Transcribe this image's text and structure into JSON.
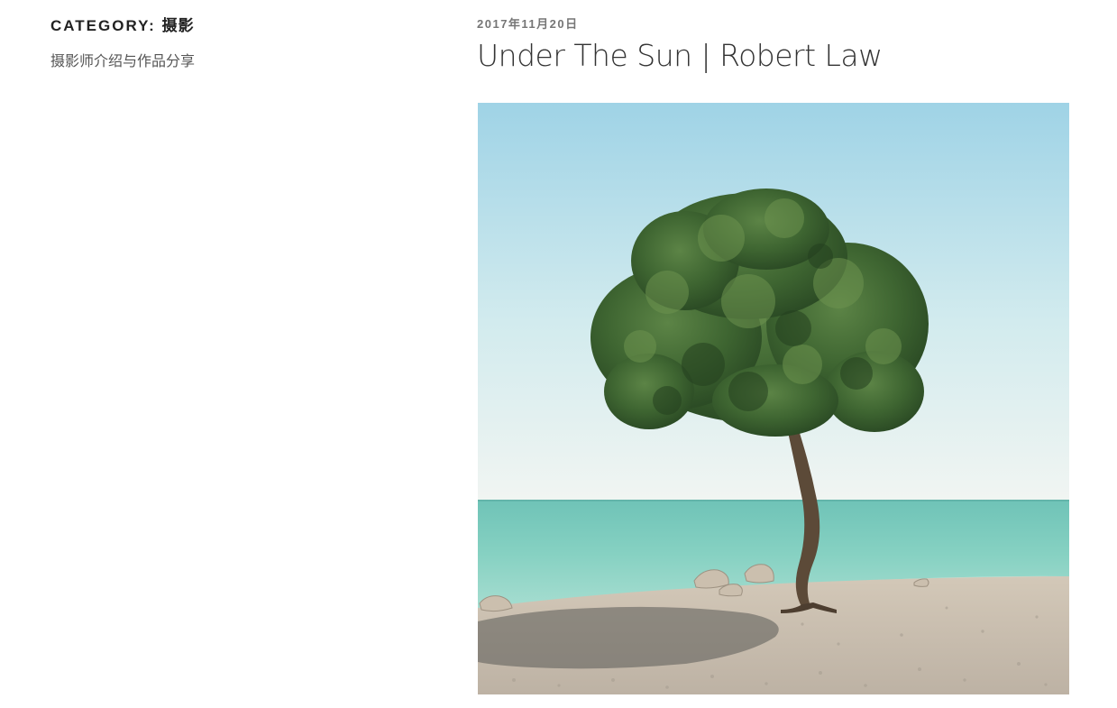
{
  "archive": {
    "label": "CATEGORY:",
    "term": "摄影",
    "description": "摄影师介绍与作品分享"
  },
  "post": {
    "date": "2017年11月20日",
    "title": "Under The Sun | Robert Law",
    "image_subject": "lone-tree-on-beach-photo"
  },
  "colors": {
    "text_dark": "#222222",
    "text_muted": "#767676",
    "sky_top": "#9fd3e6",
    "sky_bottom": "#eef6f4",
    "sea": "#7ccdbd",
    "foliage": "#3f6a33",
    "sand": "#cfc4b4"
  }
}
